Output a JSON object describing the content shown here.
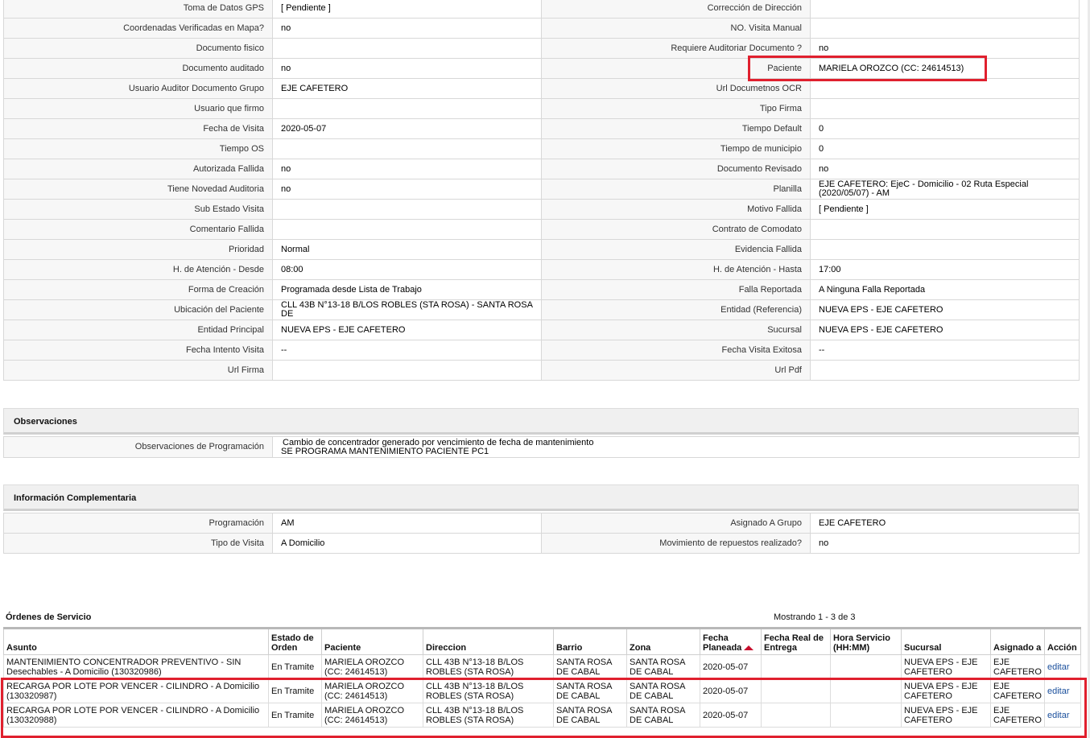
{
  "details": [
    {
      "l1": "Toma de Datos GPS",
      "v1": "[ Pendiente ]",
      "l2": "Corrección de Dirección",
      "v2": ""
    },
    {
      "l1": "Coordenadas Verificadas en Mapa?",
      "v1": " no",
      "l2": "NO. Visita Manual",
      "v2": ""
    },
    {
      "l1": "Documento fisico",
      "v1": "",
      "l2": "Requiere Auditoriar Documento ?",
      "v2": " no"
    },
    {
      "l1": "Documento auditado",
      "v1": " no",
      "l2": "Paciente",
      "v2": "MARIELA OROZCO (CC: 24614513)"
    },
    {
      "l1": "Usuario Auditor Documento Grupo",
      "v1": "EJE CAFETERO",
      "l2": "Url Documetnos OCR",
      "v2": ""
    },
    {
      "l1": "Usuario que firmo",
      "v1": "",
      "l2": "Tipo Firma",
      "v2": ""
    },
    {
      "l1": "Fecha de Visita",
      "v1": " 2020-05-07",
      "l2": "Tiempo Default",
      "v2": "0"
    },
    {
      "l1": "Tiempo OS",
      "v1": "",
      "l2": "Tiempo de municipio",
      "v2": "0"
    },
    {
      "l1": "Autorizada Fallida",
      "v1": " no",
      "l2": "Documento Revisado",
      "v2": " no"
    },
    {
      "l1": "Tiene Novedad Auditoria",
      "v1": " no",
      "l2": "Planilla",
      "v2": "EJE CAFETERO: EjeC - Domicilio - 02 Ruta Especial (2020/05/07) - AM"
    },
    {
      "l1": "Sub Estado Visita",
      "v1": "",
      "l2": "Motivo Fallida",
      "v2": "[ Pendiente ]"
    },
    {
      "l1": "Comentario Fallida",
      "v1": "",
      "l2": "Contrato de Comodato",
      "v2": ""
    },
    {
      "l1": "Prioridad",
      "v1": "Normal",
      "l2": "Evidencia Fallida",
      "v2": ""
    },
    {
      "l1": "H. de Atención - Desde",
      "v1": "08:00",
      "l2": "H. de Atención - Hasta",
      "v2": "17:00"
    },
    {
      "l1": "Forma de Creación",
      "v1": "Programada desde Lista de Trabajo",
      "l2": "Falla Reportada",
      "v2": "A Ninguna Falla Reportada"
    },
    {
      "l1": "Ubicación del Paciente",
      "v1": "CLL 43B N°13-18 B/LOS ROBLES (STA ROSA) - SANTA ROSA DE",
      "l2": "Entidad (Referencia)",
      "v2": "NUEVA EPS - EJE CAFETERO"
    },
    {
      "l1": "Entidad Principal",
      "v1": "NUEVA EPS - EJE CAFETERO",
      "l2": "Sucursal",
      "v2": "NUEVA EPS - EJE CAFETERO"
    },
    {
      "l1": "Fecha Intento Visita",
      "v1": " --",
      "l2": "Fecha Visita Exitosa",
      "v2": " --"
    },
    {
      "l1": "Url Firma",
      "v1": "",
      "l2": "Url Pdf",
      "v2": ""
    }
  ],
  "observaciones": {
    "title": "Observaciones",
    "label": "Observaciones de Programación",
    "line1": "Cambio de concentrador generado por vencimiento de fecha de mantenimiento",
    "line2": "SE PROGRAMA MANTENIMIENTO PACIENTE PC1"
  },
  "complementaria": {
    "title": "Información Complementaria",
    "rows": [
      {
        "l1": "Programación",
        "v1": "AM",
        "l2": "Asignado A Grupo",
        "v2": "EJE CAFETERO"
      },
      {
        "l1": "Tipo de Visita",
        "v1": "A Domicilio",
        "l2": "Movimiento de repuestos realizado?",
        "v2": " no"
      }
    ]
  },
  "ordenes": {
    "title": "Órdenes de Servicio",
    "showing": "Mostrando 1 - 3 de 3",
    "headers": [
      "Asunto",
      "Estado de Orden",
      "Paciente",
      "Direccion",
      "Barrio",
      "Zona",
      "Fecha Planeada",
      "Fecha Real de Entrega",
      "Hora Servicio (HH:MM)",
      "Sucursal",
      "Asignado a",
      "Acción"
    ],
    "rows": [
      {
        "asunto": "MANTENIMIENTO CONCENTRADOR PREVENTIVO - SIN Desechables - A Domicilio (130320986)",
        "estado": "En Tramite",
        "paciente": "MARIELA OROZCO (CC: 24614513)",
        "direccion": "CLL 43B N°13-18 B/LOS ROBLES (STA ROSA)",
        "barrio": "SANTA ROSA DE CABAL",
        "zona": "SANTA ROSA DE CABAL",
        "fecha": "2020-05-07",
        "real": "",
        "hora": "",
        "sucursal": "NUEVA EPS - EJE CAFETERO",
        "asignado": "EJE CAFETERO",
        "accion": "editar"
      },
      {
        "asunto": "RECARGA POR LOTE POR VENCER - CILINDRO - A Domicilio (130320987)",
        "estado": "En Tramite",
        "paciente": "MARIELA OROZCO (CC: 24614513)",
        "direccion": "CLL 43B N°13-18 B/LOS ROBLES (STA ROSA)",
        "barrio": "SANTA ROSA DE CABAL",
        "zona": "SANTA ROSA DE CABAL",
        "fecha": "2020-05-07",
        "real": "",
        "hora": "",
        "sucursal": "NUEVA EPS - EJE CAFETERO",
        "asignado": "EJE CAFETERO",
        "accion": "editar"
      },
      {
        "asunto": "RECARGA POR LOTE POR VENCER - CILINDRO - A Domicilio (130320988)",
        "estado": "En Tramite",
        "paciente": "MARIELA OROZCO (CC: 24614513)",
        "direccion": "CLL 43B N°13-18 B/LOS ROBLES (STA ROSA)",
        "barrio": "SANTA ROSA DE CABAL",
        "zona": "SANTA ROSA DE CABAL",
        "fecha": "2020-05-07",
        "real": "",
        "hora": "",
        "sucursal": "NUEVA EPS - EJE CAFETERO",
        "asignado": "EJE CAFETERO",
        "accion": "editar"
      }
    ]
  },
  "colors": {
    "highlight": "#e0202e",
    "sort_arrow": "#c8102e",
    "link": "#1a4f9c"
  }
}
